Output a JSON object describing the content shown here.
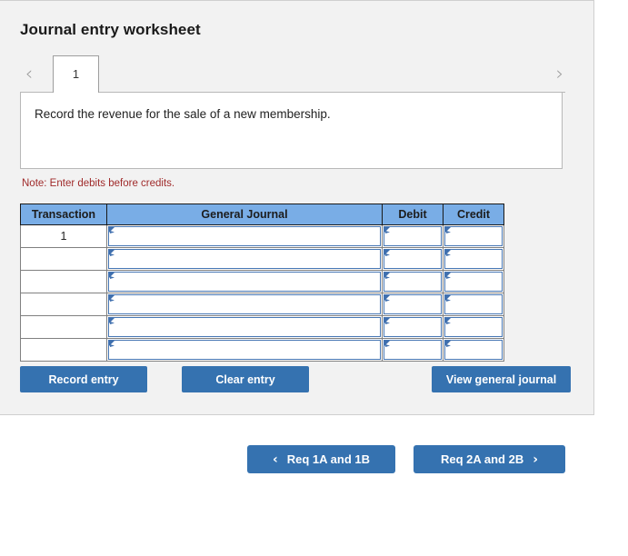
{
  "panel": {
    "title": "Journal entry worksheet"
  },
  "tabs": {
    "prev_icon": "chevron-left-icon",
    "next_icon": "chevron-right-icon",
    "prev_glyph": "‹",
    "next_glyph": "›",
    "items": [
      {
        "label": "1",
        "active": true
      }
    ]
  },
  "prompt": {
    "text": "Record the revenue for the sale of a new membership."
  },
  "note": {
    "text": "Note: Enter debits before credits."
  },
  "journal": {
    "columns": [
      "Transaction",
      "General Journal",
      "Debit",
      "Credit"
    ],
    "rows": [
      {
        "transaction": "1",
        "general_journal": "",
        "debit": "",
        "credit": ""
      },
      {
        "transaction": "",
        "general_journal": "",
        "debit": "",
        "credit": ""
      },
      {
        "transaction": "",
        "general_journal": "",
        "debit": "",
        "credit": ""
      },
      {
        "transaction": "",
        "general_journal": "",
        "debit": "",
        "credit": ""
      },
      {
        "transaction": "",
        "general_journal": "",
        "debit": "",
        "credit": ""
      },
      {
        "transaction": "",
        "general_journal": "",
        "debit": "",
        "credit": ""
      }
    ]
  },
  "actions": {
    "record_entry": "Record entry",
    "clear_entry": "Clear entry",
    "view_general_journal": "View general journal"
  },
  "bottom_nav": {
    "prev_label": "Req 1A and 1B",
    "next_label": "Req 2A and 2B",
    "prev_chevron": "‹",
    "next_chevron": "›"
  },
  "colors": {
    "panel_background": "#f2f2f2",
    "button_blue": "#3572b0",
    "table_header_blue": "#79ade6",
    "input_border_blue": "#4676b4",
    "note_red": "#a02b2b"
  }
}
